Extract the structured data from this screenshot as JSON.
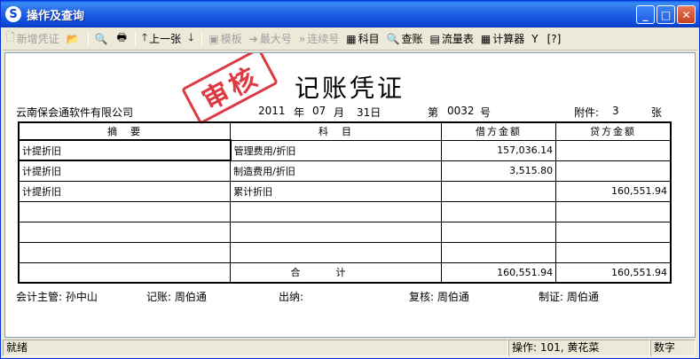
{
  "window": {
    "title": "操作及查询",
    "app_icon": "S"
  },
  "toolbar": {
    "new": "新增凭证",
    "prev": "上一张",
    "template": "模板",
    "max_no": "最大号",
    "continuous_no": "连续号",
    "subject": "科目",
    "ledger": "查账",
    "cashflow": "流量表",
    "calculator": "计算器"
  },
  "voucher": {
    "title": "记账凭证",
    "stamp": "审核",
    "company": "云南保会通软件有限公司",
    "year": "2011",
    "year_unit": "年",
    "month": "07",
    "month_unit": "月",
    "day": "31日",
    "no_prefix": "第",
    "no": "0032",
    "no_unit": "号",
    "attach_label": "附件:",
    "attach_count": "3",
    "attach_unit": "张",
    "headers": {
      "summary": "摘　要",
      "subject": "科　目",
      "debit": "借方金额",
      "credit": "贷方金额"
    },
    "rows": [
      {
        "summary": "计提折旧",
        "subject": "管理费用/折旧",
        "debit": "157,036.14",
        "credit": ""
      },
      {
        "summary": "计提折旧",
        "subject": "制造费用/折旧",
        "debit": "3,515.80",
        "credit": ""
      },
      {
        "summary": "计提折旧",
        "subject": "累计折旧",
        "debit": "",
        "credit": "160,551.94"
      },
      {
        "summary": "",
        "subject": "",
        "debit": "",
        "credit": ""
      },
      {
        "summary": "",
        "subject": "",
        "debit": "",
        "credit": ""
      },
      {
        "summary": "",
        "subject": "",
        "debit": "",
        "credit": ""
      }
    ],
    "total_label": "合计",
    "total_debit": "160,551.94",
    "total_credit": "160,551.94",
    "supervisor": "会计主管: 孙中山",
    "bookkeeper": "记账: 周伯通",
    "cashier": "出纳:",
    "reviewer": "复核: 周伯通",
    "maker": "制证: 周伯通"
  },
  "status": {
    "ready": "就绪",
    "operator": "操作: 101, 黄花菜",
    "mode": "数字"
  }
}
